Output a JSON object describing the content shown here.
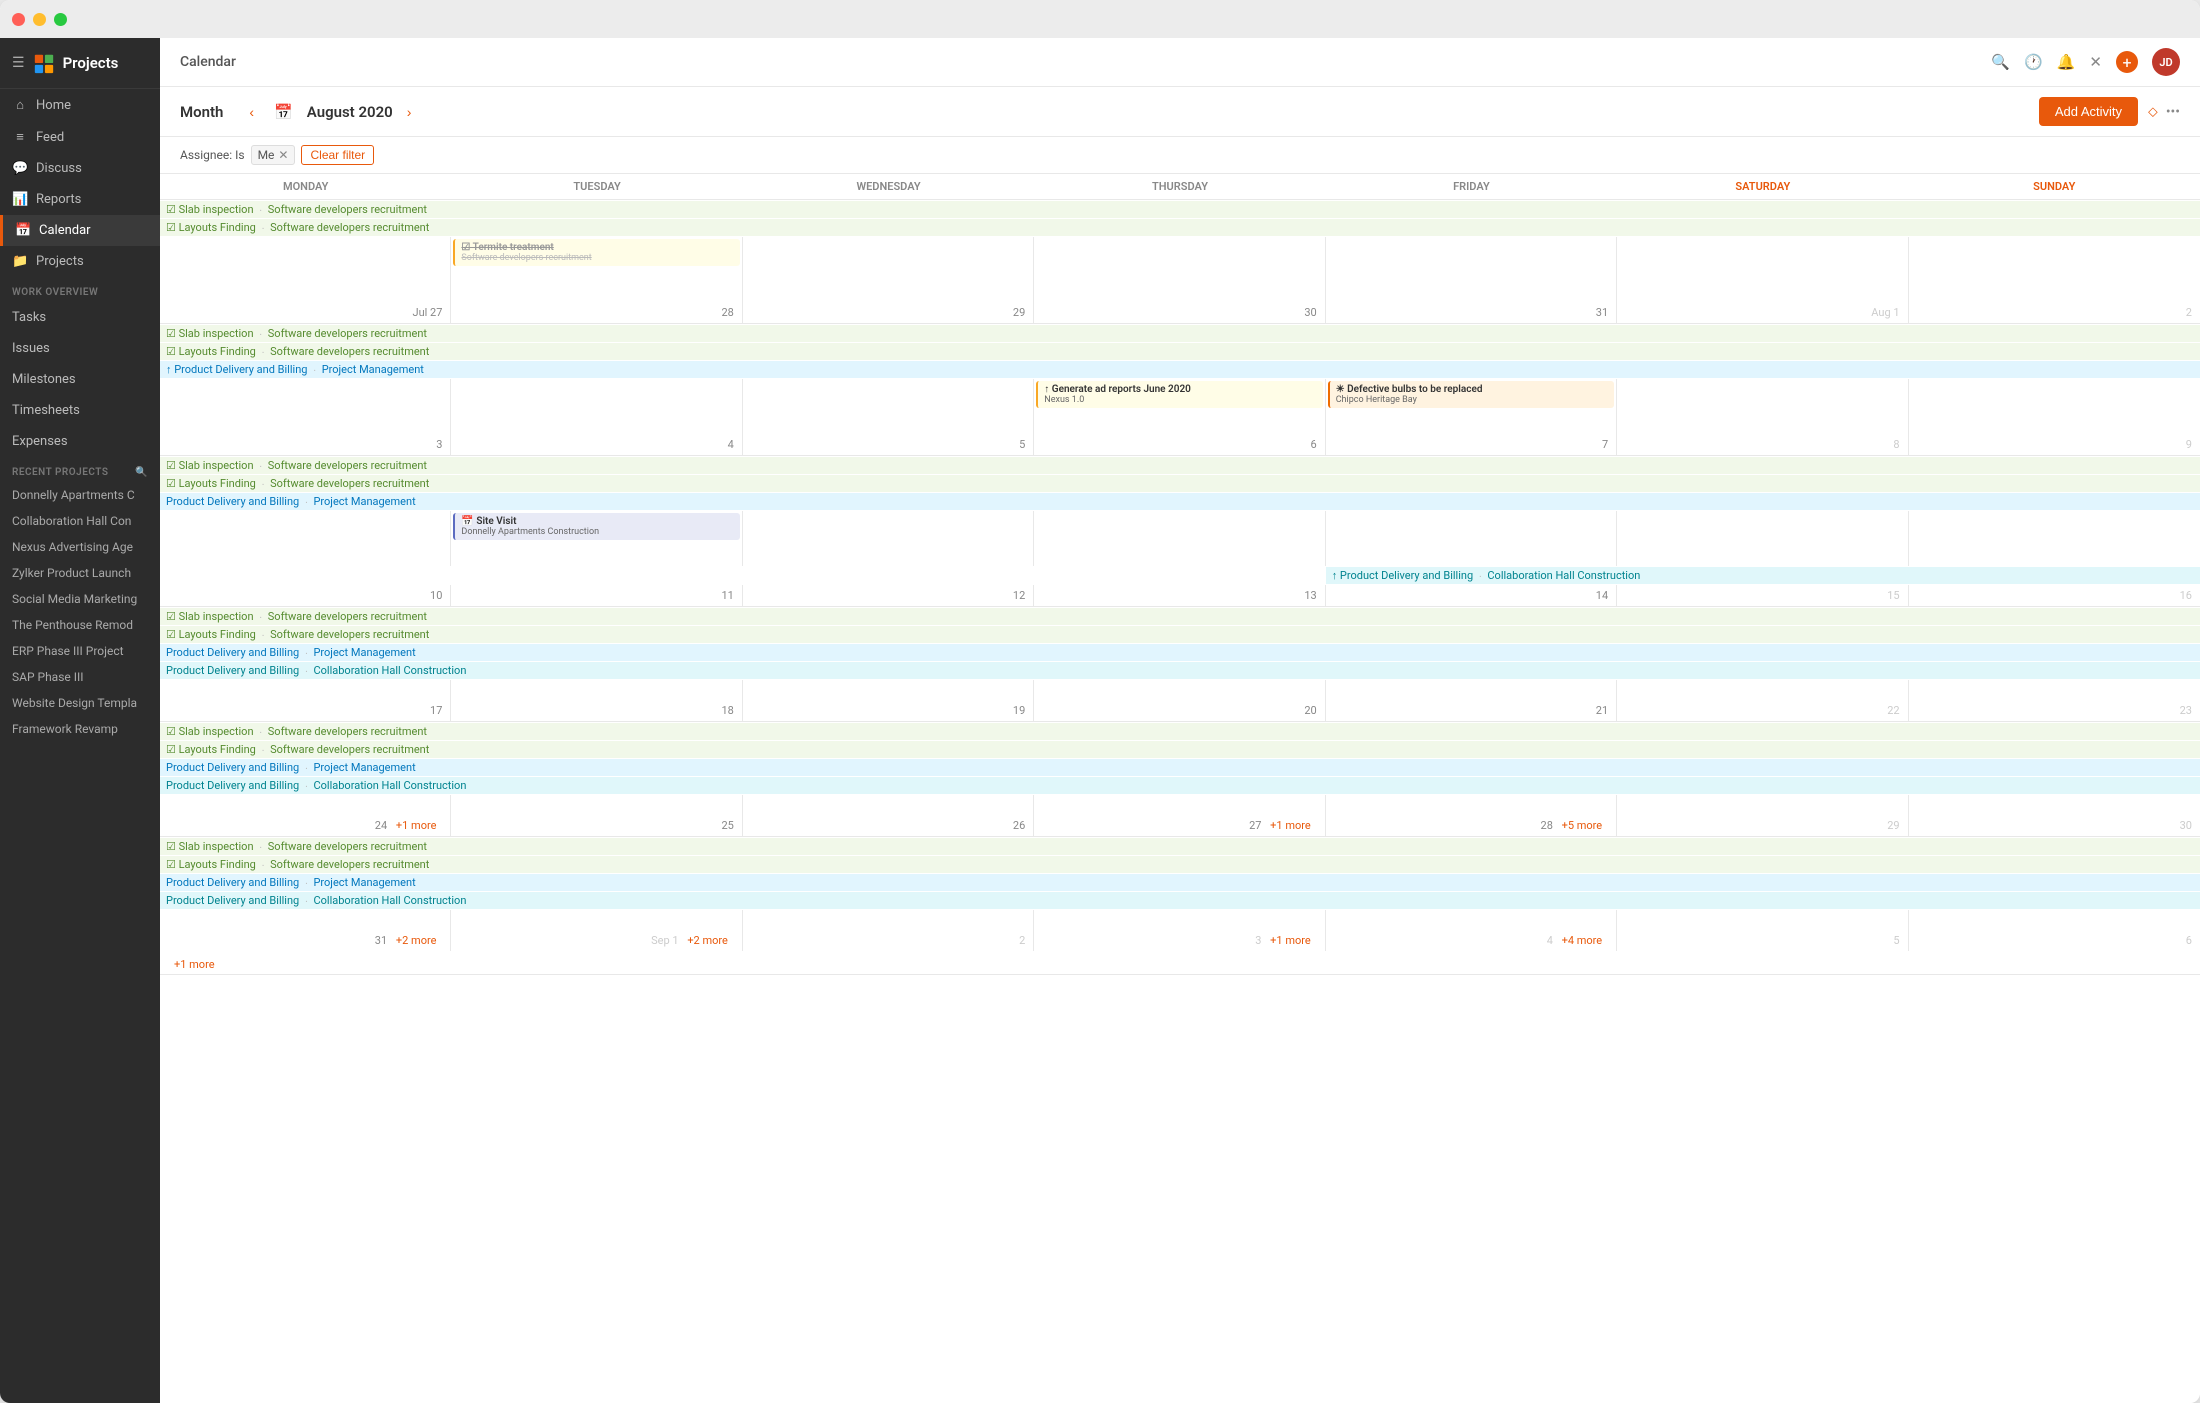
{
  "window": {
    "dots": [
      "red",
      "yellow",
      "green"
    ]
  },
  "sidebar": {
    "logo": "Projects",
    "nav": [
      {
        "id": "home",
        "label": "Home",
        "icon": "⌂"
      },
      {
        "id": "feed",
        "label": "Feed",
        "icon": "≡"
      },
      {
        "id": "discuss",
        "label": "Discuss",
        "icon": "💬"
      },
      {
        "id": "reports",
        "label": "Reports",
        "icon": "📊"
      },
      {
        "id": "calendar",
        "label": "Calendar",
        "icon": "📅",
        "active": true
      },
      {
        "id": "projects",
        "label": "Projects",
        "icon": "📁"
      }
    ],
    "work_overview_label": "WORK OVERVIEW",
    "work_items": [
      {
        "id": "tasks",
        "label": "Tasks"
      },
      {
        "id": "issues",
        "label": "Issues"
      },
      {
        "id": "milestones",
        "label": "Milestones"
      },
      {
        "id": "timesheets",
        "label": "Timesheets"
      },
      {
        "id": "expenses",
        "label": "Expenses"
      }
    ],
    "recent_label": "RECENT PROJECTS",
    "recent_projects": [
      {
        "id": "donnelly",
        "label": "Donnelly Apartments C"
      },
      {
        "id": "collab",
        "label": "Collaboration Hall Con"
      },
      {
        "id": "nexus",
        "label": "Nexus Advertising Age"
      },
      {
        "id": "zylker",
        "label": "Zylker Product Launch"
      },
      {
        "id": "social",
        "label": "Social Media Marketing"
      },
      {
        "id": "penthouse",
        "label": "The Penthouse Remod"
      },
      {
        "id": "erp",
        "label": "ERP Phase III Project"
      },
      {
        "id": "sap",
        "label": "SAP Phase III"
      },
      {
        "id": "website",
        "label": "Website Design Templa"
      },
      {
        "id": "framework",
        "label": "Framework Revamp"
      }
    ]
  },
  "header": {
    "title": "Calendar",
    "icons": [
      "search",
      "clock",
      "bell",
      "close",
      "plus"
    ],
    "avatar_initials": "JD"
  },
  "toolbar": {
    "view_label": "Month",
    "month_year": "August 2020",
    "add_activity_label": "Add Activity"
  },
  "filter": {
    "label": "Assignee: Is",
    "value": "Me",
    "clear_label": "Clear filter"
  },
  "calendar": {
    "days": [
      "MONDAY",
      "TUESDAY",
      "WEDNESDAY",
      "THURSDAY",
      "FRIDAY",
      "SATURDAY",
      "SUNDAY"
    ],
    "weeks": [
      {
        "id": "week0",
        "show_floating": true,
        "dates": [
          {
            "num": "",
            "other": true
          },
          {
            "num": "",
            "other": true
          },
          {
            "num": "",
            "other": true
          },
          {
            "num": "",
            "other": true
          },
          {
            "num": "",
            "other": true
          },
          {
            "num": "",
            "other": true
          },
          {
            "num": "",
            "other": true
          }
        ],
        "top_cards": [
          {
            "col": 1,
            "colspan": 7,
            "label": "Slab inspection ∙ Software developers recruitment",
            "class": "green-band"
          },
          {
            "col": 1,
            "colspan": 7,
            "label": "Layouts Finding ∙ Software developers recruitment",
            "class": "green-band"
          }
        ],
        "card_row": {
          "col2": {
            "card": {
              "type": "yellow",
              "title_strike": "Termite treatment",
              "sub_strike": "Software developers recruitment"
            }
          }
        }
      },
      {
        "id": "week1",
        "dates": [
          {
            "num": "Jul 27",
            "other": false
          },
          {
            "num": "28",
            "other": false
          },
          {
            "num": "29",
            "other": false
          },
          {
            "num": "30",
            "other": false
          },
          {
            "num": "31",
            "other": false
          },
          {
            "num": "Aug 1",
            "other": true
          },
          {
            "num": "2",
            "other": true
          }
        ],
        "bands": [
          {
            "label": "Slab inspection ∙ Software developers recruitment",
            "class": "green-band",
            "start": 1,
            "span": 7
          },
          {
            "label": "Layouts Finding ∙ Software developers recruitment",
            "class": "green-band",
            "start": 1,
            "span": 7
          },
          {
            "label": "↑ Product Delivery and Billing ∙ Project Management",
            "class": "blue-band",
            "start": 1,
            "span": 7
          }
        ],
        "cards": [
          {
            "col": 4,
            "type": "yellow",
            "icon": "↑",
            "title": "Generate ad reports June 2020",
            "sub": "Nexus 1.0"
          },
          {
            "col": 5,
            "type": "orange",
            "icon": "☀",
            "title": "Defective bulbs to be replaced",
            "sub": "Chipco Heritage Bay"
          }
        ]
      },
      {
        "id": "week2",
        "dates": [
          {
            "num": "3",
            "other": false
          },
          {
            "num": "4",
            "other": false
          },
          {
            "num": "5",
            "other": false
          },
          {
            "num": "6",
            "other": false
          },
          {
            "num": "7",
            "other": false
          },
          {
            "num": "8",
            "other": true
          },
          {
            "num": "9",
            "other": true
          }
        ],
        "bands": [
          {
            "label": "Slab inspection ∙ Software developers recruitment",
            "class": "green-band",
            "start": 1,
            "span": 7
          },
          {
            "label": "Layouts Finding ∙ Software developers recruitment",
            "class": "green-band",
            "start": 1,
            "span": 7
          },
          {
            "label": "Product Delivery and Billing ∙ Project Management",
            "class": "blue-band",
            "start": 1,
            "span": 7
          }
        ],
        "cards": [
          {
            "col": 2,
            "type": "blue_card",
            "icon": "📅",
            "title": "Site Visit",
            "sub": "Donnelly Apartments Construction"
          },
          {
            "col": 5,
            "type": "teal_card",
            "icon": "↑",
            "title": "Product Delivery and Billing ∙ Collaboration Hall Construction",
            "sub": ""
          }
        ]
      },
      {
        "id": "week3",
        "dates": [
          {
            "num": "10",
            "other": false
          },
          {
            "num": "11",
            "other": false
          },
          {
            "num": "12",
            "other": false
          },
          {
            "num": "13",
            "other": false
          },
          {
            "num": "14",
            "other": false
          },
          {
            "num": "15",
            "other": true
          },
          {
            "num": "16",
            "other": true
          }
        ],
        "bands": [
          {
            "label": "Slab inspection ∙ Software developers recruitment",
            "class": "green-band"
          },
          {
            "label": "Layouts Finding ∙ Software developers recruitment",
            "class": "green-band"
          },
          {
            "label": "Product Delivery and Billing ∙ Project Management",
            "class": "blue-band"
          },
          {
            "label": "Product Delivery and Billing ∙ Collaboration Hall Construction",
            "class": "teal-band"
          }
        ]
      },
      {
        "id": "week4",
        "dates": [
          {
            "num": "17",
            "other": false
          },
          {
            "num": "18",
            "other": false
          },
          {
            "num": "19",
            "other": false
          },
          {
            "num": "20",
            "other": false
          },
          {
            "num": "21",
            "other": false
          },
          {
            "num": "22",
            "other": true
          },
          {
            "num": "23",
            "other": true
          }
        ],
        "bands": [
          {
            "label": "Slab inspection ∙ Software developers recruitment",
            "class": "green-band"
          },
          {
            "label": "Layouts Finding ∙ Software developers recruitment",
            "class": "green-band"
          },
          {
            "label": "Product Delivery and Billing ∙ Project Management",
            "class": "blue-band"
          },
          {
            "label": "Product Delivery and Billing ∙ Collaboration Hall Construction",
            "class": "teal-band"
          }
        ]
      },
      {
        "id": "week5",
        "dates": [
          {
            "num": "24",
            "other": false,
            "more": "+1 more"
          },
          {
            "num": "25",
            "other": false
          },
          {
            "num": "26",
            "other": false
          },
          {
            "num": "27",
            "other": false,
            "more": "+1 more"
          },
          {
            "num": "28",
            "other": false,
            "more": "+5 more"
          },
          {
            "num": "29",
            "other": true
          },
          {
            "num": "30",
            "other": true
          }
        ],
        "bands": [
          {
            "label": "Slab inspection ∙ Software developers recruitment",
            "class": "green-band"
          },
          {
            "label": "Layouts Finding ∙ Software developers recruitment",
            "class": "green-band"
          },
          {
            "label": "Product Delivery and Billing ∙ Project Management",
            "class": "blue-band"
          },
          {
            "label": "Product Delivery and Billing ∙ Collaboration Hall Construction",
            "class": "teal-band"
          }
        ]
      },
      {
        "id": "week6",
        "dates": [
          {
            "num": "31",
            "other": false,
            "more": "+2 more"
          },
          {
            "num": "Sep 1",
            "other": true,
            "more": "+2 more"
          },
          {
            "num": "2",
            "other": true
          },
          {
            "num": "3",
            "other": true,
            "more": "+1 more"
          },
          {
            "num": "4",
            "other": true,
            "more": "+4 more"
          },
          {
            "num": "5",
            "other": true
          },
          {
            "num": "6",
            "other": true
          }
        ],
        "bottom_more": "+1 more",
        "bands": [
          {
            "label": "Slab inspection ∙ Software developers recruitment",
            "class": "green-band"
          },
          {
            "label": "Layouts Finding ∙ Software developers recruitment",
            "class": "green-band"
          },
          {
            "label": "Product Delivery and Billing ∙ Project Management",
            "class": "blue-band"
          },
          {
            "label": "Product Delivery and Billing ∙ Collaboration Hall Construction",
            "class": "teal-band"
          }
        ]
      }
    ]
  }
}
